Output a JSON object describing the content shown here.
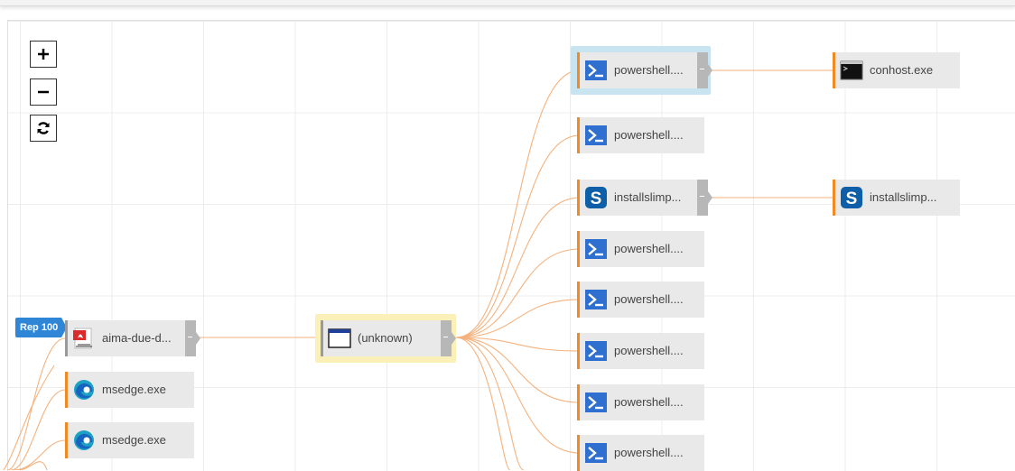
{
  "zoom_controls": {
    "zoom_in_icon": "plus-icon",
    "zoom_out_icon": "minus-icon",
    "reset_icon": "refresh-icon"
  },
  "badge": {
    "label": "Rep 100",
    "color": "#2f86d6"
  },
  "colors": {
    "edge": "#f4b27e",
    "node_accent": "#f08a24",
    "node_bg": "#e9e9e9",
    "selected_blue": "#c8e4f1",
    "selected_yellow": "#fbf1b8"
  },
  "nodes": {
    "aima": {
      "label": "aima-due-d...",
      "icon": "pdf-icon"
    },
    "msedge1": {
      "label": "msedge.exe",
      "icon": "edge-browser-icon"
    },
    "msedge2": {
      "label": "msedge.exe",
      "icon": "edge-browser-icon"
    },
    "unknown": {
      "label": "(unknown)",
      "icon": "window-icon"
    },
    "ps1": {
      "label": "powershell....",
      "icon": "powershell-icon"
    },
    "ps2": {
      "label": "powershell....",
      "icon": "powershell-icon"
    },
    "install1": {
      "label": "installslimp...",
      "icon": "installer-s-icon"
    },
    "ps3": {
      "label": "powershell....",
      "icon": "powershell-icon"
    },
    "ps4": {
      "label": "powershell....",
      "icon": "powershell-icon"
    },
    "ps5": {
      "label": "powershell....",
      "icon": "powershell-icon"
    },
    "ps6": {
      "label": "powershell....",
      "icon": "powershell-icon"
    },
    "ps7": {
      "label": "powershell....",
      "icon": "powershell-icon"
    },
    "conhost": {
      "label": "conhost.exe",
      "icon": "console-icon"
    },
    "install2": {
      "label": "installslimp...",
      "icon": "installer-s-icon"
    }
  }
}
